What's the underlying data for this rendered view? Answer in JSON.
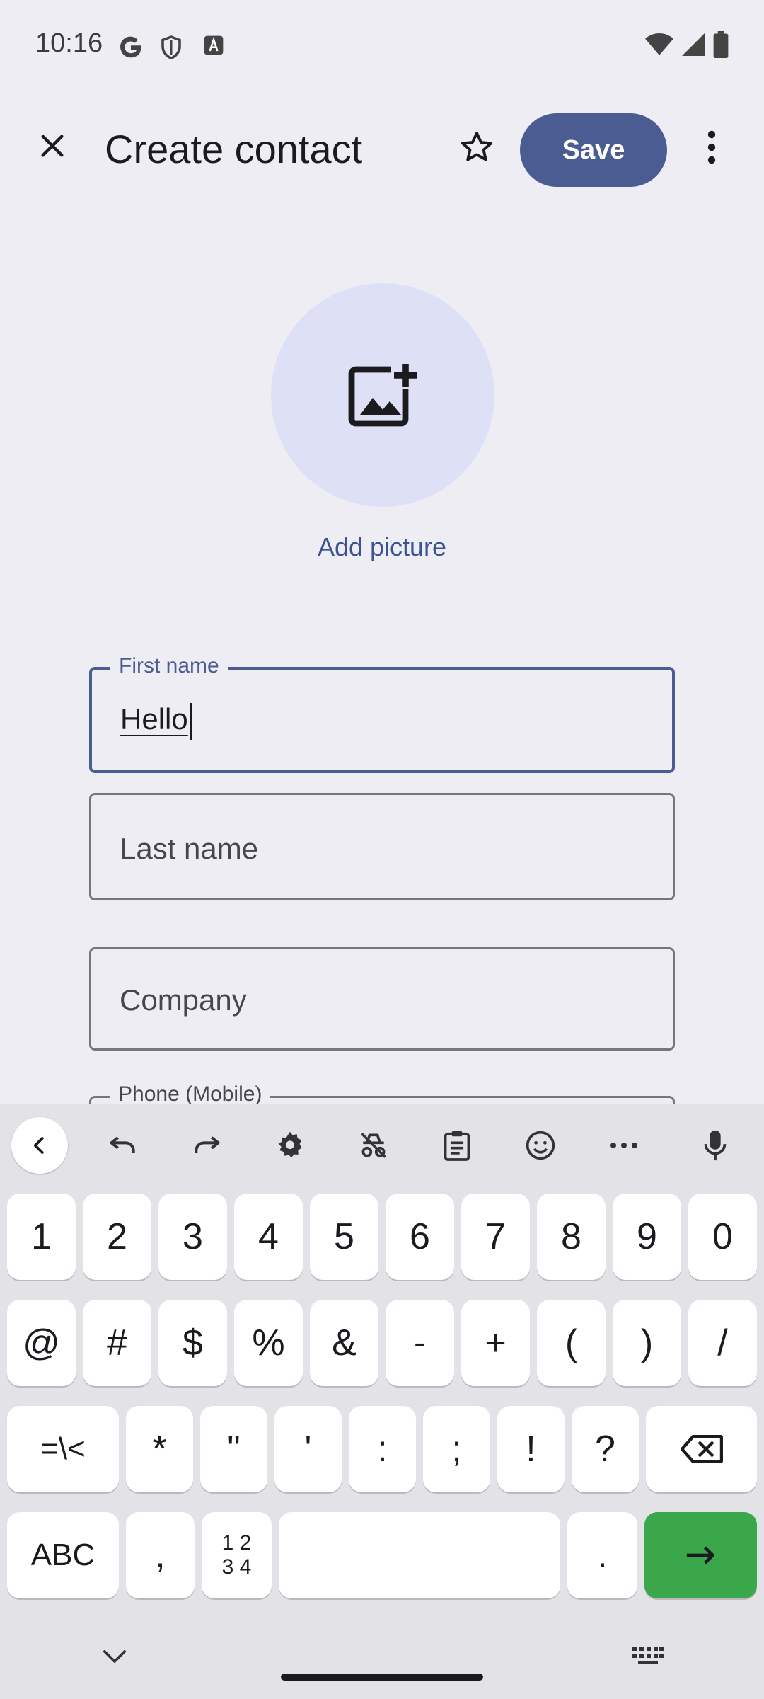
{
  "status": {
    "time": "10:16"
  },
  "appbar": {
    "title": "Create contact",
    "save_label": "Save"
  },
  "photo": {
    "add_label": "Add picture"
  },
  "form": {
    "first_name": {
      "label": "First name",
      "value": "Hello"
    },
    "last_name": {
      "placeholder": "Last name"
    },
    "company": {
      "placeholder": "Company"
    },
    "phone": {
      "label": "Phone (Mobile)"
    }
  },
  "keyboard": {
    "row1": [
      "1",
      "2",
      "3",
      "4",
      "5",
      "6",
      "7",
      "8",
      "9",
      "0"
    ],
    "row2": [
      "@",
      "#",
      "$",
      "%",
      "&",
      "-",
      "+",
      "(",
      ")",
      "/"
    ],
    "row3": [
      "=\\<",
      "*",
      "\"",
      "'",
      ":",
      ";",
      "!",
      "?"
    ],
    "row4": {
      "abc": "ABC",
      "comma": ",",
      "numpad_top": "1 2",
      "numpad_bottom": "3 4",
      "period": "."
    }
  },
  "colors": {
    "accent": "#4a5c92",
    "enter": "#3aa84a"
  }
}
